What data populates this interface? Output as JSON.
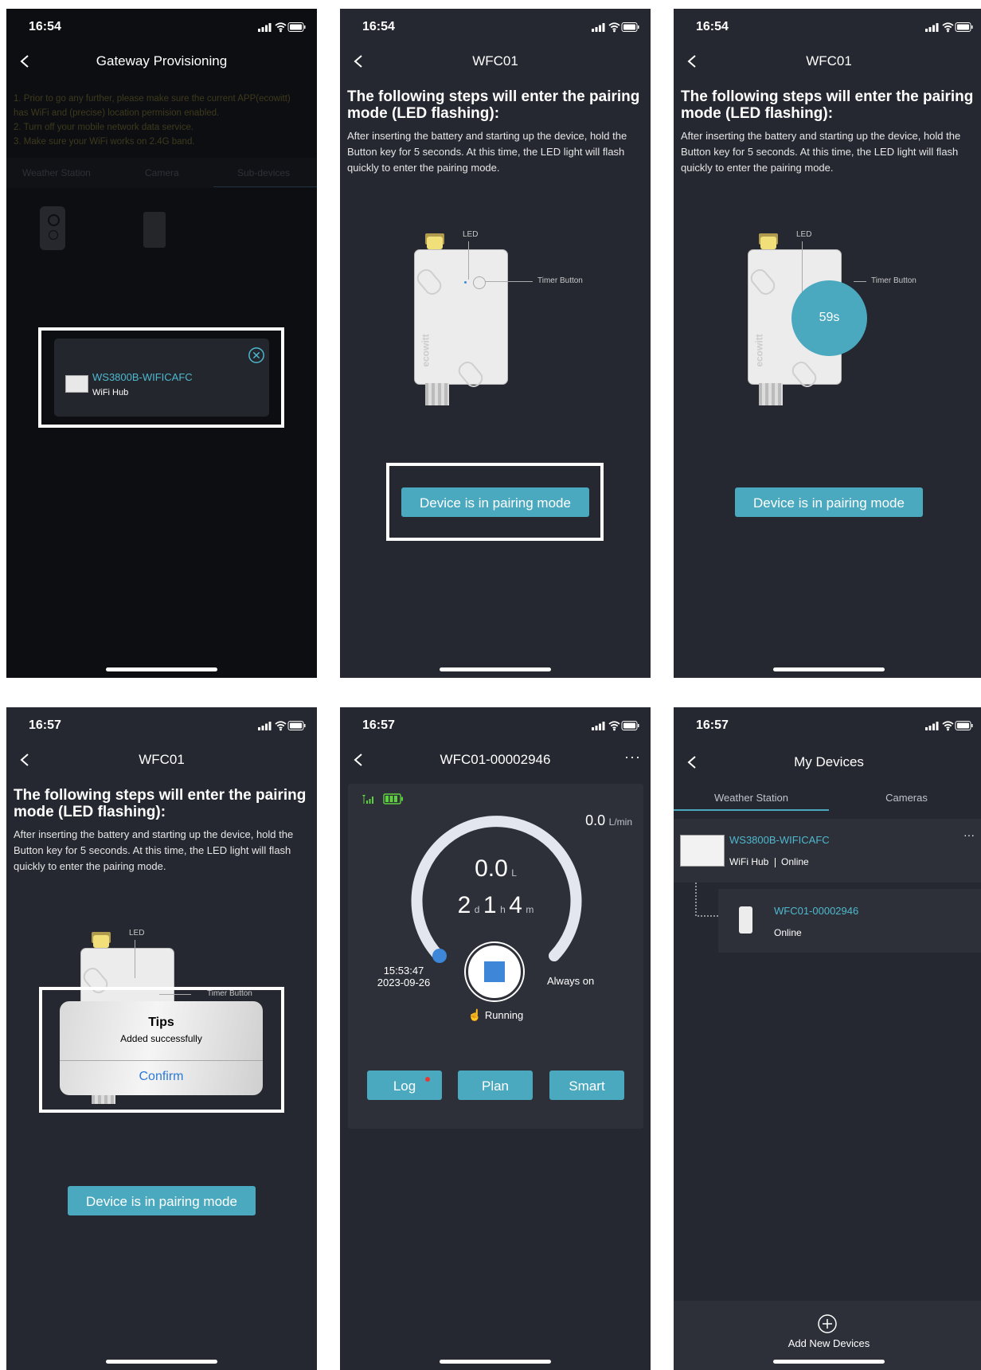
{
  "panels": {
    "p1": {
      "time": "16:54",
      "title": "Gateway Provisioning",
      "tips": [
        "1. Prior to go any further, please make sure the current APP(ecowitt)",
        "has WiFi and (precise) location permision enabled.",
        "2. Turn off your mobile network data service.",
        "3. Make sure your WiFi works on 2.4G band."
      ],
      "tabs": [
        "Weather Station",
        "Camera",
        "Sub-devices"
      ],
      "popup": {
        "device_name": "WS3800B-WIFICAFC",
        "device_type": "WiFi Hub"
      }
    },
    "p2": {
      "time": "16:54",
      "title": "WFC01",
      "heading": "The following steps will enter the pairing mode (LED flashing):",
      "instructions": "After inserting the battery and starting up the device, hold the Button key for 5 seconds. At this time, the LED light will flash quickly to enter the pairing mode.",
      "led_label": "LED",
      "timer_label": "Timer Button",
      "brand_text": "ecowitt",
      "pair_button": "Device is in pairing mode"
    },
    "p3": {
      "time": "16:54",
      "title": "WFC01",
      "heading": "The following steps will enter the pairing mode (LED flashing):",
      "instructions": "After inserting the battery and starting up the device, hold the Button key for 5 seconds. At this time, the LED light will flash quickly to enter the pairing mode.",
      "led_label": "LED",
      "timer_label": "Timer Button",
      "countdown": "59s",
      "brand_text": "ecowitt",
      "pair_button": "Device is in pairing mode"
    },
    "p4": {
      "time": "16:57",
      "title": "WFC01",
      "heading": "The following steps will enter the pairing mode (LED flashing):",
      "instructions": "After inserting the battery and starting up the device, hold the Button key for 5 seconds. At this time, the LED light will flash quickly to enter the pairing mode.",
      "led_label": "LED",
      "timer_label": "Timer Button",
      "dialog": {
        "title": "Tips",
        "message": "Added successfully",
        "confirm": "Confirm"
      },
      "pair_button": "Device is in pairing mode"
    },
    "p5": {
      "time": "16:57",
      "title": "WFC01-00002946",
      "more": "···",
      "flow_value": "0.0",
      "flow_unit": "L/min",
      "volume_value": "0.0",
      "volume_unit": "L",
      "duration": {
        "d": "2",
        "d_unit": "d",
        "h": "1",
        "h_unit": "h",
        "m": "4",
        "m_unit": "m"
      },
      "start_time": "15:53:47",
      "start_date": "2023-09-26",
      "mode": "Always on",
      "status": "Running",
      "buttons": {
        "log": "Log",
        "plan": "Plan",
        "smart": "Smart"
      }
    },
    "p6": {
      "time": "16:57",
      "title": "My Devices",
      "tabs": [
        "Weather Station",
        "Cameras"
      ],
      "hub": {
        "name": "WS3800B-WIFICAFC",
        "type": "WiFi Hub",
        "status": "Online",
        "more": "···"
      },
      "sub": {
        "name": "WFC01-00002946",
        "status": "Online"
      },
      "add_label": "Add New Devices"
    }
  },
  "colors": {
    "accent": "#4aa9bf",
    "panel_bg": "#252830",
    "card_bg": "#2d3038",
    "link_blue": "#2b7ad8",
    "device_teal": "#4fb8cf",
    "gauge_track": "#e3e6ee",
    "gauge_knob": "#3e86d8",
    "battery_green": "#5ecf3f",
    "badge_red": "#e53935"
  },
  "icons": [
    "back-chevron-icon",
    "signal-icon",
    "wifi-icon",
    "battery-icon",
    "close-circle-icon",
    "stop-icon",
    "hand-icon",
    "add-circle-icon"
  ]
}
